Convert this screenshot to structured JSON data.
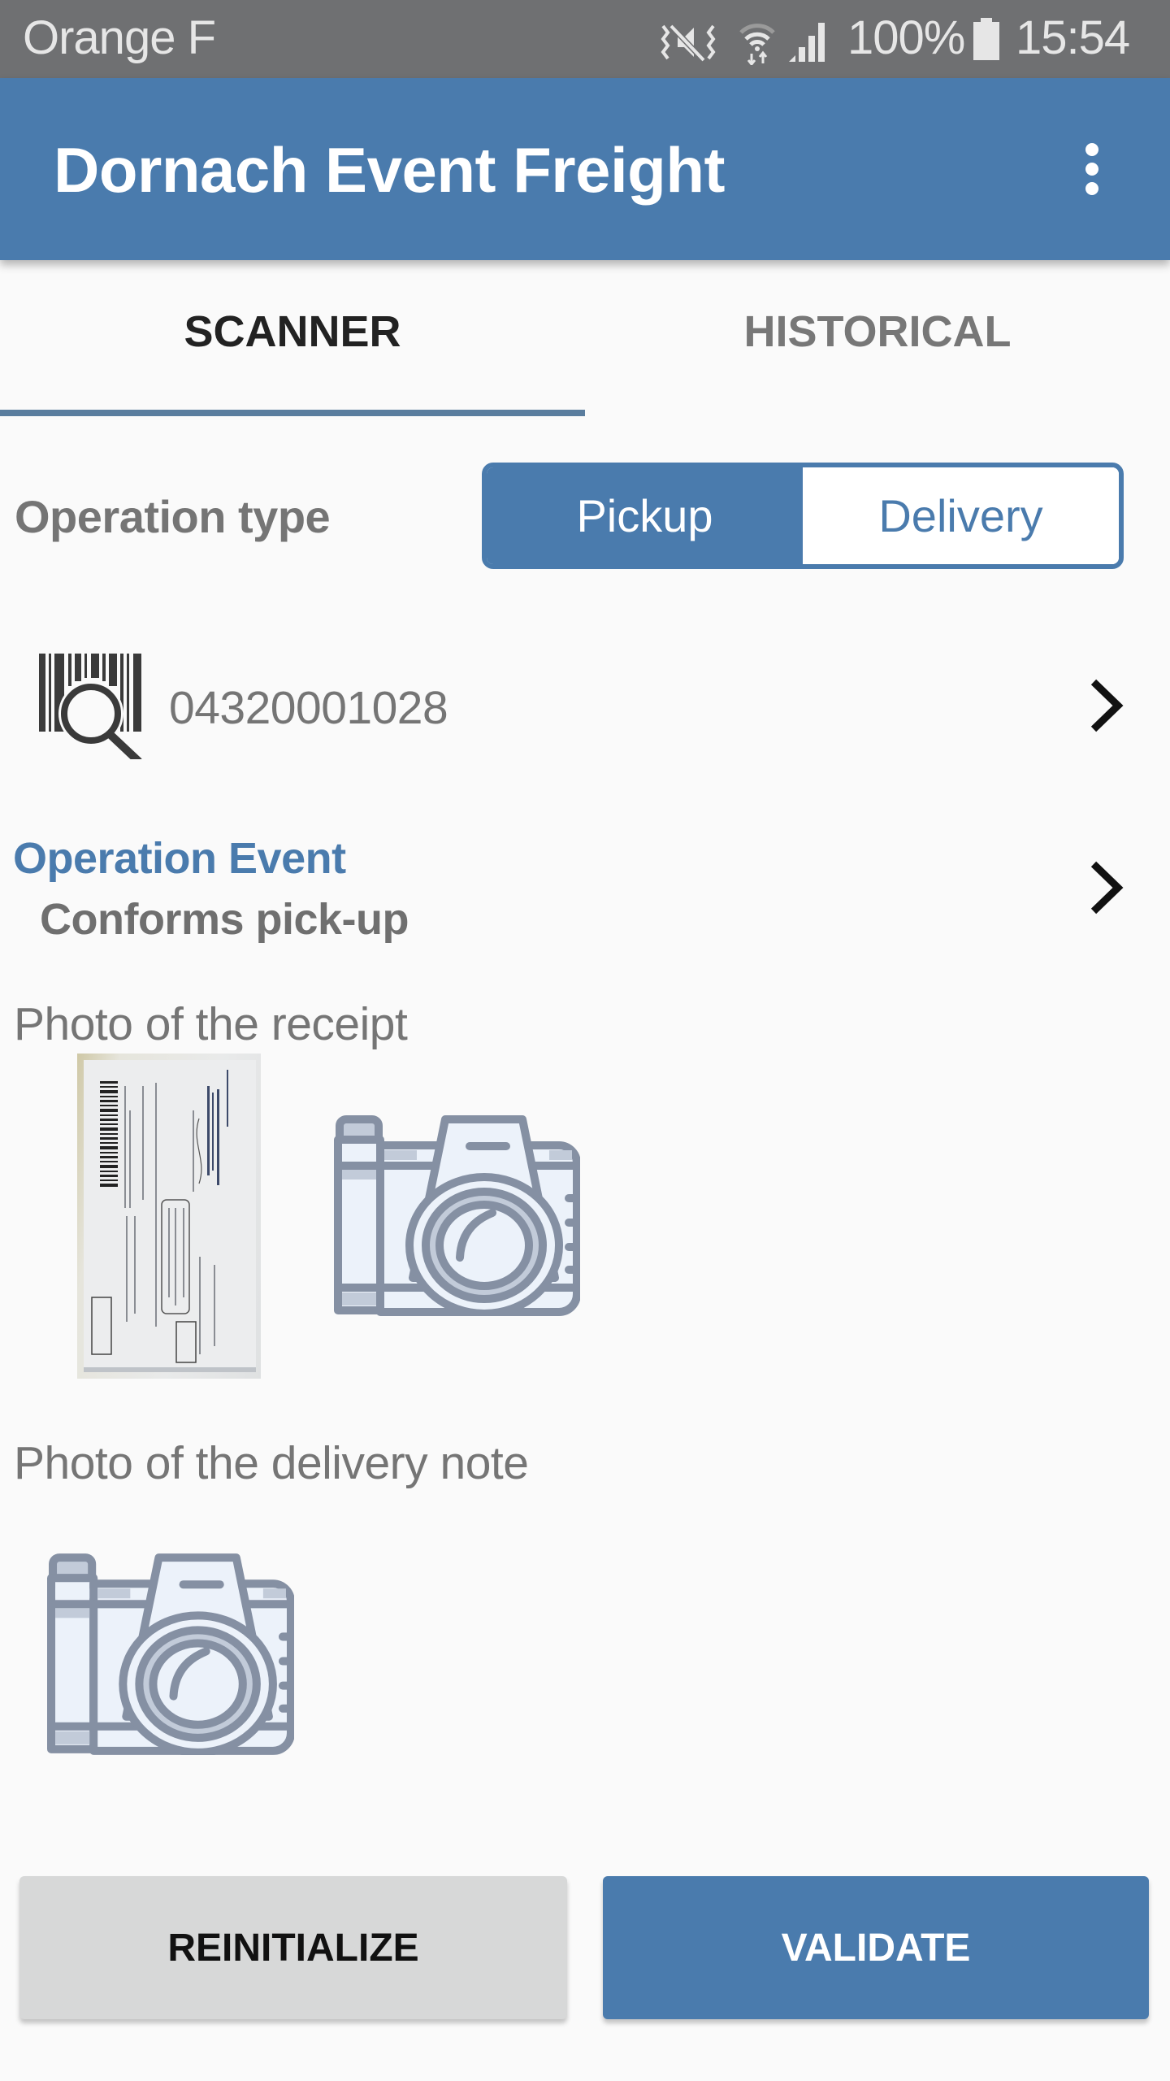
{
  "status_bar": {
    "carrier": "Orange F",
    "icons": [
      "vibrate-mute-icon",
      "wifi-icon",
      "signal-icon",
      "battery-icon"
    ],
    "battery_percent": "100%",
    "time": "15:54"
  },
  "app_bar": {
    "title": "Dornach Event Freight",
    "overflow_icon": "more-vert-icon"
  },
  "tabs": [
    {
      "label": "SCANNER",
      "active": true
    },
    {
      "label": "HISTORICAL",
      "active": false
    }
  ],
  "operation_type": {
    "label": "Operation type",
    "options": [
      "Pickup",
      "Delivery"
    ],
    "selected": "Pickup"
  },
  "barcode": {
    "icon": "barcode-search-icon",
    "value": "04320001028"
  },
  "operation_event": {
    "label": "Operation Event",
    "value": "Conforms pick-up"
  },
  "photos": {
    "receipt_label": "Photo of the receipt",
    "delivery_note_label": "Photo of the delivery note"
  },
  "buttons": {
    "reinitialize": "REINITIALIZE",
    "validate": "VALIDATE"
  },
  "colors": {
    "primary": "#4a7bad",
    "status_bar": "#6f7072",
    "background": "#fafafa",
    "secondary_button": "#d7d8d8"
  }
}
